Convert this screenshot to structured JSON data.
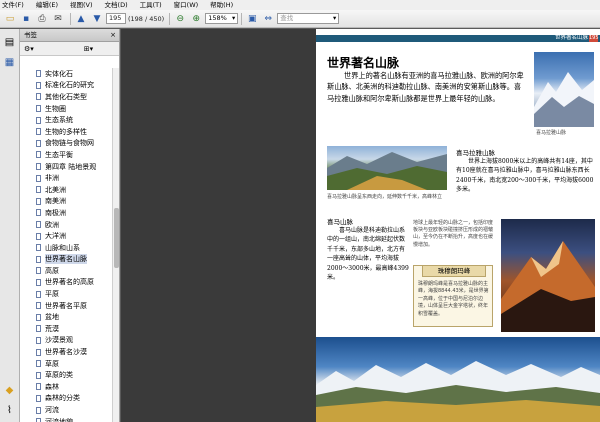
{
  "menu": {
    "items": [
      "文件(F)",
      "编辑(E)",
      "视图(V)",
      "文档(D)",
      "工具(T)",
      "窗口(W)",
      "帮助(H)"
    ]
  },
  "toolbar": {
    "page_input": "195",
    "page_count": "(198 / 450)",
    "zoom": "158%",
    "search_placeholder": "查找"
  },
  "panel": {
    "title": "书签",
    "close": "×",
    "bookmarks": [
      "实体化石",
      "标准化石的研究",
      "其他化石类型",
      "生物圈",
      "生态系统",
      "生物的多样性",
      "食物链与食物网",
      "生态平衡",
      "第四章  陆地景观",
      "非洲",
      "北美洲",
      "南美洲",
      "南极洲",
      "欧洲",
      "大洋洲",
      "山脉和山系",
      "世界著名山脉",
      "高原",
      "世界著名的高原",
      "平原",
      "世界著名平原",
      "盆地",
      "荒漠",
      "沙漠景观",
      "世界著名沙漠",
      "草原",
      "草原的类",
      "森林",
      "森林的分类",
      "河流",
      "河流地貌",
      "河流污方"
    ],
    "selected_index": 16
  },
  "page": {
    "header_text": "世界著名山脉",
    "page_number": "195",
    "title": "世界著名山脉",
    "intro": "世界上的著名山脉有亚洲的喜马拉雅山脉、欧洲的阿尔卑斯山脉、北美洲的科迪勒拉山脉、南美洲的安第斯山脉等。喜马拉雅山脉和阿尔卑斯山脉都是世界上最年轻的山脉。",
    "photo1_caption": "喜马拉雅山脉",
    "himalaya_heading": "喜马拉雅山脉",
    "himalaya_body": "世界上海拔8000米以上的高峰共有14座，其中有10座就在喜马拉雅山脉中，喜马拉雅山脉东西长2400千米，南北宽200～300千米，平均海拔6000多米。",
    "photo2_caption": "喜马拉雅山脉呈东西走向，延伸数千千米，高峰林立",
    "alps_heading": "喜马山脉",
    "alps_body": "喜马山脉是科迪勒拉山系中的一组山，南北绵延起伏数千千米，东部多山地，北方有一座高耸的山体，平均海拔2000～3000米，最高峰4399米。",
    "side_note": "地球上最年轻的山脉之一，包括印度板块与亚欧板块碰撞挤压形成的褶皱山，至今仍在不断抬升，高度也在缓慢增加。",
    "box_title": "珠穆朗玛峰",
    "box_body": "珠穆朗玛峰是喜马拉雅山脉的主峰，海拔8844.43米，是世界第一高峰，位于中国与尼泊尔边境，山体呈巨大金字塔状，终年积雪覆盖。"
  },
  "colors": {
    "header_blue": "#1f5a7a",
    "box_fill": "#fbf6e4",
    "page_accent": "#d04a3a"
  }
}
